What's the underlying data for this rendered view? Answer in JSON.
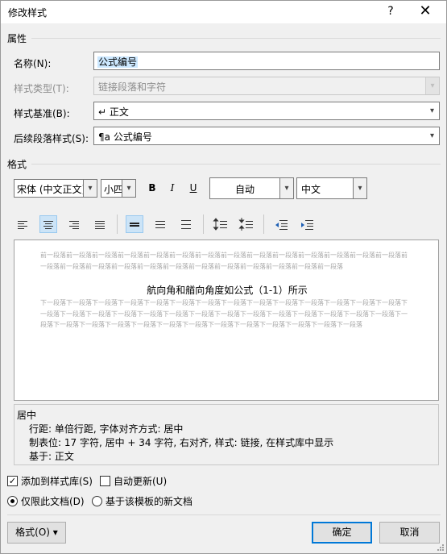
{
  "window": {
    "title": "修改样式",
    "help": "?",
    "close": "✕"
  },
  "properties": {
    "section": "属性",
    "name": {
      "label": "名称(N):",
      "value": "公式编号"
    },
    "style_type": {
      "label": "样式类型(T):",
      "value": "链接段落和字符"
    },
    "based_on": {
      "label": "样式基准(B):",
      "icon": "↵",
      "value": "正文"
    },
    "next_para": {
      "label": "后续段落样式(S):",
      "icon": "¶a",
      "value": "公式编号"
    }
  },
  "format": {
    "section": "格式",
    "font": "宋体 (中文正文)",
    "size": "小四",
    "bold": "B",
    "italic": "I",
    "underline": "U",
    "color": "自动",
    "language": "中文"
  },
  "preview": {
    "prev_text": "前一段落前一段落前一段落前一段落前一段落前一段落前一段落前一段落前一段落前一段落前一段落前一段落前一段落前一段落前一段落前一段落前一段落前一段落前一段落前一段落前一段落前一段落前一段落前一段落前一段落前一段落",
    "sample_text": "航向角和艏向角度如公式（1-1）所示",
    "next_text": "下一段落下一段落下一段落下一段落下一段落下一段落下一段落下一段落下一段落下一段落下一段落下一段落下一段落下一段落下一段落下一段落下一段落下一段落下一段落下一段落下一段落下一段落下一段落下一段落下一段落下一段落下一段落下一段落下一段落下一段落下一段落下一段落下一段落下一段落下一段落下一段落下一段落下一段落下一段落下一段落下一段落"
  },
  "description": {
    "line1": "居中",
    "line2": "行距: 单倍行距, 字体对齐方式: 居中",
    "line3": "制表位:  17 字符, 居中 +  34 字符, 右对齐, 样式: 链接, 在样式库中显示",
    "line4": "基于: 正文"
  },
  "options": {
    "add_to_gallery": {
      "label": "添加到样式库(S)",
      "checked": true
    },
    "auto_update": {
      "label": "自动更新(U)",
      "checked": false
    },
    "only_this_doc": {
      "label": "仅限此文档(D)",
      "selected": true
    },
    "new_docs_template": {
      "label": "基于该模板的新文档",
      "selected": false
    }
  },
  "buttons": {
    "format": "格式(O) ▾",
    "ok": "确定",
    "cancel": "取消"
  }
}
